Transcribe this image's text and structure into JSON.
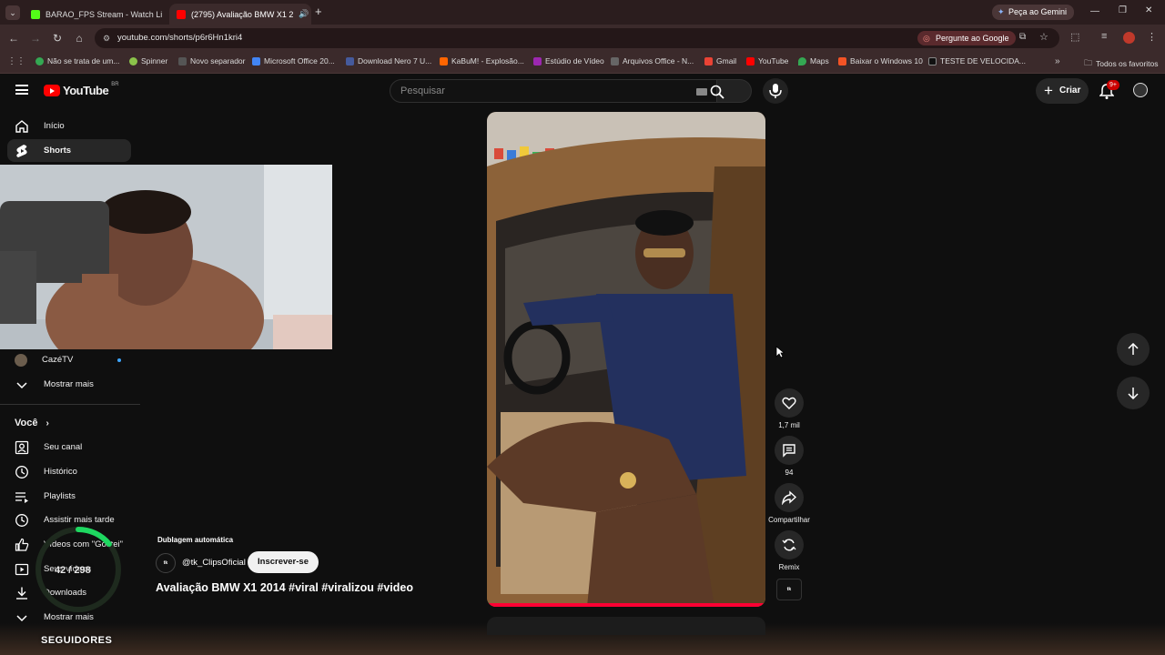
{
  "browser": {
    "tabs": [
      {
        "title": "BARAO_FPS Stream - Watch Li",
        "active": false
      },
      {
        "title": "(2795) Avaliação BMW X1 2",
        "active": true
      }
    ],
    "gemini_label": "Peça ao Gemini",
    "url": "youtube.com/shorts/p6r6Hn1kri4",
    "ask_google": "Pergunte ao Google",
    "bookmarks": [
      "Não se trata de um...",
      "Spinner",
      "Novo separador",
      "Microsoft Office 20...",
      "Download Nero 7 U...",
      "KaBuM! - Explosão...",
      "Estúdio de Vídeo",
      "Arquivos Office - N...",
      "Gmail",
      "YouTube",
      "Maps",
      "Baixar o Windows 10",
      "TESTE DE VELOCIDA..."
    ],
    "all_bookmarks": "Todos os favoritos"
  },
  "youtube": {
    "logo_text": "YouTube",
    "logo_region": "BR",
    "search_placeholder": "Pesquisar",
    "create_label": "Criar",
    "notif_badge": "9+"
  },
  "sidebar": {
    "top": [
      {
        "label": "Início",
        "icon": "home-icon"
      },
      {
        "label": "Shorts",
        "icon": "shorts-icon",
        "active": true
      }
    ],
    "subscription": "CazéTV",
    "show_more_1": "Mostrar mais",
    "you_heading": "Você",
    "you_items": [
      {
        "label": "Seu canal",
        "icon": "channel-icon"
      },
      {
        "label": "Histórico",
        "icon": "history-icon"
      },
      {
        "label": "Playlists",
        "icon": "playlists-icon"
      },
      {
        "label": "Assistir mais tarde",
        "icon": "watch-later-icon"
      },
      {
        "label": "Vídeos com \"Gostei\"",
        "icon": "like-icon"
      },
      {
        "label": "Seus vídeos",
        "icon": "your-videos-icon"
      },
      {
        "label": "Downloads",
        "icon": "download-icon"
      }
    ],
    "show_more_2": "Mostrar mais"
  },
  "short": {
    "dub_label": "Dublagem automática",
    "channel": "@tk_ClipsOficial",
    "subscribe": "Inscrever-se",
    "title": "Avaliação BMW X1 2014 #viral #viralizou #video",
    "likes": "1,7 mil",
    "comments": "94",
    "share": "Compartilhar",
    "remix": "Remix"
  },
  "stream_overlay": {
    "follower_count": "42 / 298",
    "follower_progress": 0.14,
    "followers_label": "SEGUIDORES"
  }
}
